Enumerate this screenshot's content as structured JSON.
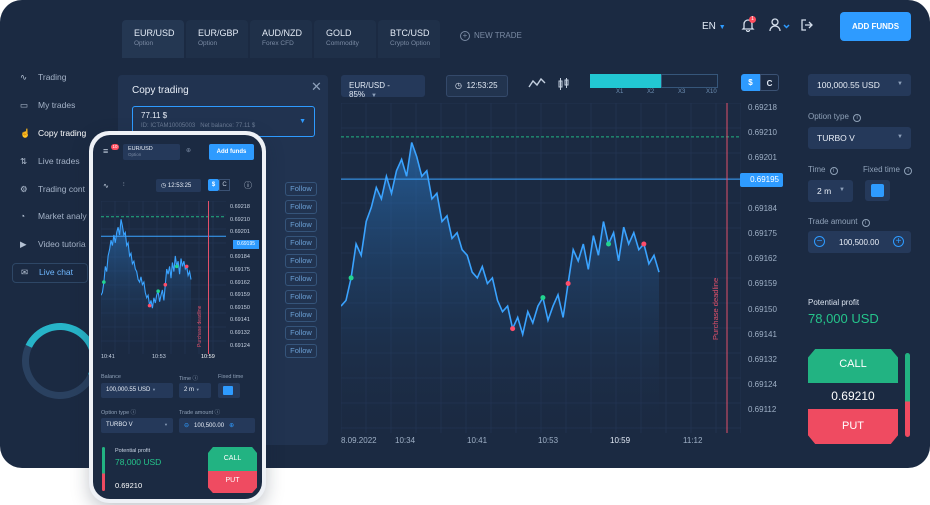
{
  "tabs": [
    {
      "pair": "EUR/USD",
      "type": "Option"
    },
    {
      "pair": "EUR/GBP",
      "type": "Option"
    },
    {
      "pair": "AUD/NZD",
      "type": "Forex CFD"
    },
    {
      "pair": "GOLD",
      "type": "Commodity"
    },
    {
      "pair": "BTC/USD",
      "type": "Crypto Option"
    }
  ],
  "new_trade": "NEW TRADE",
  "language": "EN",
  "notifications_count": "1",
  "add_funds": "ADD FUNDS",
  "sidebar": [
    {
      "label": "Trading",
      "icon": "pulse-icon"
    },
    {
      "label": "My trades",
      "icon": "archive-icon"
    },
    {
      "label": "Copy trading",
      "icon": "hand-icon"
    },
    {
      "label": "Live trades",
      "icon": "arrows-icon"
    },
    {
      "label": "Trading cont",
      "icon": "contest-icon"
    },
    {
      "label": "Market analy",
      "icon": "gauge-icon"
    },
    {
      "label": "Video tutoria",
      "icon": "video-icon"
    },
    {
      "label": "Live chat",
      "icon": "chat-icon"
    }
  ],
  "copy_panel": {
    "title": "Copy trading",
    "balance": "77.11 $",
    "id_text": "ID: ICTAM10005003",
    "net_balance": "Net balance: 77.11 $",
    "follow_label": "Follow",
    "follow_count": 10
  },
  "toolbar": {
    "pair_label": "EUR/USD - 85%",
    "time": "12:53:25",
    "multipliers": [
      "X1",
      "X2",
      "X3",
      "X10"
    ],
    "currency_on": "$",
    "currency_off": "C"
  },
  "chart_data": {
    "type": "line",
    "title": "",
    "y_ticks": [
      "0.69218",
      "0.69210",
      "0.69201",
      "0.69195",
      "0.69184",
      "0.69175",
      "0.69162",
      "0.69159",
      "0.69150",
      "0.69141",
      "0.69132",
      "0.69124",
      "0.69112"
    ],
    "x_ticks": [
      "8.09.2022",
      "10:34",
      "10:41",
      "10:53",
      "10:59",
      "11:12"
    ],
    "current_price": "0.69195",
    "deadline_label": "Purchase deadline",
    "ylim": [
      0.69105,
      0.69222
    ],
    "series": [
      {
        "values": [
          0.6915,
          0.69152,
          0.6916,
          0.69172,
          0.69168,
          0.6918,
          0.69185,
          0.69192,
          0.69188,
          0.69196,
          0.6919,
          0.69198,
          0.69202,
          0.69196,
          0.69208,
          0.69203,
          0.69196,
          0.69198,
          0.69188,
          0.6919,
          0.6918,
          0.69182,
          0.69174,
          0.69176,
          0.6917,
          0.69168,
          0.69162,
          0.6916,
          0.69164,
          0.69158,
          0.6916,
          0.69152,
          0.69148,
          0.6915,
          0.69142,
          0.69146,
          0.6914,
          0.69148,
          0.69144,
          0.6915,
          0.69153,
          0.69145,
          0.6915,
          0.69154,
          0.69146,
          0.69158,
          0.6917,
          0.69166,
          0.69172,
          0.69163,
          0.69175,
          0.69168,
          0.6918,
          0.69172,
          0.69176,
          0.69166,
          0.69178,
          0.69172,
          0.69176,
          0.6917,
          0.69172,
          0.69165,
          0.69168,
          0.69162
        ]
      }
    ],
    "green_markers": [
      2,
      40,
      53
    ],
    "red_markers": [
      34,
      45,
      60
    ]
  },
  "right_panel": {
    "balance": "100,000.55 USD",
    "option_type_label": "Option type",
    "option_type": "TURBO V",
    "time_label": "Time",
    "time_value": "2 m",
    "fixed_time_label": "Fixed time",
    "amount_label": "Trade amount",
    "amount_value": "100,500.00",
    "profit_label": "Potential profit",
    "profit_value": "78,000 USD",
    "call": "CALL",
    "put": "PUT",
    "price": "0.69210"
  },
  "phone": {
    "tab_pair": "EUR/USD",
    "tab_type": "Option",
    "add_funds": "Add funds",
    "time": "12:53:25",
    "currency_on": "$",
    "currency_off": "C",
    "y_ticks": [
      "0.69218",
      "0.69210",
      "0.69201",
      "0.69195",
      "0.69184",
      "0.69175",
      "0.69162",
      "0.69159",
      "0.69150",
      "0.69141",
      "0.69132",
      "0.69124"
    ],
    "x_ticks": [
      "10:41",
      "10:53",
      "10:59"
    ],
    "deadline": "Purchase deadline",
    "balance_label": "Balance",
    "balance": "100,000.55 USD",
    "time_label": "Time",
    "time_value": "2 m",
    "fixed_label": "Fixed time",
    "option_label": "Option type",
    "option_value": "TURBO V",
    "amount_label": "Trade amount",
    "amount_value": "100,500.00",
    "profit_label": "Potential profit",
    "profit_value": "78,000 USD",
    "price": "0.69210",
    "call": "CALL",
    "put": "PUT",
    "badge": "10"
  },
  "colors": {
    "accent": "#2e9bff",
    "call": "#22b382",
    "put": "#ef4b61",
    "bg": "#1b2a42"
  }
}
